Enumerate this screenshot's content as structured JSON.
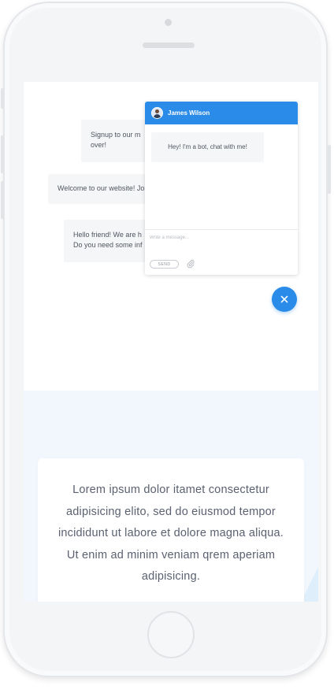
{
  "colors": {
    "accent": "#2b8be8",
    "lower_background": "#f1f7fd",
    "text": "#5b6170"
  },
  "chat_bubbles": [
    {
      "text": "Signup to our m\nover!"
    },
    {
      "text": "Welcome to our website! Join us now!"
    },
    {
      "text": "Hello friend! We are h\nDo you need some inf"
    }
  ],
  "chat_window": {
    "agent_name": "James Wilson",
    "avatar_icon": "user-avatar",
    "bot_message": "Hey! I'm a bot, chat with me!",
    "input_placeholder": "Write a message...",
    "send_label": "SEND",
    "attach_icon": "paperclip-icon"
  },
  "fab": {
    "icon": "close-icon"
  },
  "card": {
    "text": "Lorem ipsum dolor itamet consectetur adipisicing elito, sed do eiusmod tempor incididunt ut labore et dolore magna aliqua. Ut enim ad minim veniam qrem aperiam adipisicing."
  }
}
